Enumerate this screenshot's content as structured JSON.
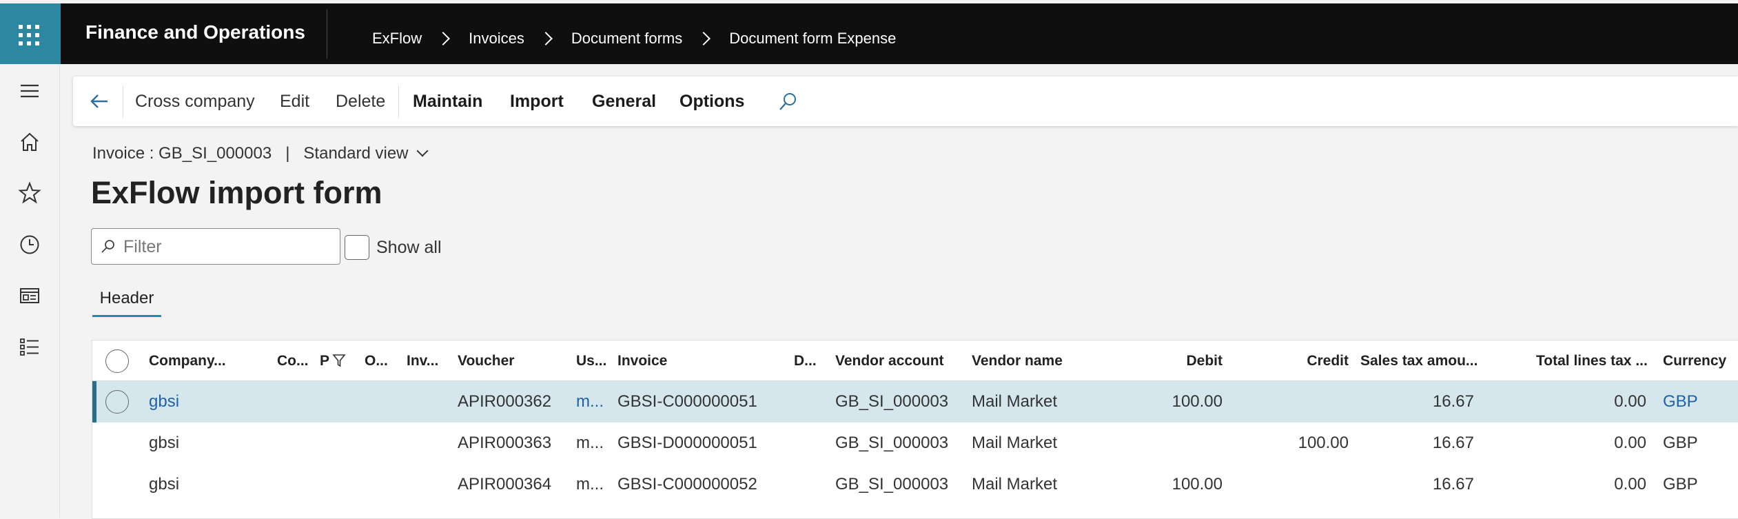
{
  "app": {
    "title": "Finance and Operations"
  },
  "breadcrumb": [
    "ExFlow",
    "Invoices",
    "Document forms",
    "Document form Expense"
  ],
  "actions": {
    "cross_company": "Cross company",
    "edit": "Edit",
    "delete": "Delete",
    "maintain": "Maintain",
    "import": "Import",
    "general": "General",
    "options": "Options"
  },
  "header": {
    "record": "Invoice : GB_SI_000003",
    "separator": "|",
    "view": "Standard view",
    "title": "ExFlow import form"
  },
  "filter": {
    "placeholder": "Filter",
    "show_all_label": "Show all"
  },
  "tabs": [
    "Header"
  ],
  "table": {
    "columns": [
      "Company...",
      "Co...",
      "P",
      "O...",
      "Inv...",
      "Voucher",
      "Us...",
      "Invoice",
      "D...",
      "Vendor account",
      "Vendor name",
      "Debit",
      "Credit",
      "Sales tax amou...",
      "Total lines tax ...",
      "Currency"
    ],
    "rows": [
      {
        "company": "gbsi",
        "voucher": "APIR000362",
        "user": "m...",
        "invoice": "GBSI-C000000051",
        "vendor_account": "GB_SI_000003",
        "vendor_name": "Mail Market",
        "debit": "100.00",
        "credit": "",
        "sales_tax": "16.67",
        "total_lines_tax": "0.00",
        "currency": "GBP"
      },
      {
        "company": "gbsi",
        "voucher": "APIR000363",
        "user": "m...",
        "invoice": "GBSI-D000000051",
        "vendor_account": "GB_SI_000003",
        "vendor_name": "Mail Market",
        "debit": "",
        "credit": "100.00",
        "sales_tax": "16.67",
        "total_lines_tax": "0.00",
        "currency": "GBP"
      },
      {
        "company": "gbsi",
        "voucher": "APIR000364",
        "user": "m...",
        "invoice": "GBSI-C000000052",
        "vendor_account": "GB_SI_000003",
        "vendor_name": "Mail Market",
        "debit": "100.00",
        "credit": "",
        "sales_tax": "16.67",
        "total_lines_tax": "0.00",
        "currency": "GBP"
      }
    ]
  },
  "colors": {
    "accent": "#2b88a0",
    "top_bar": "#0f0f0f",
    "selected_row": "#d5e7ec",
    "link": "#1f61a8"
  },
  "icons": [
    "waffle-icon",
    "hamburger-icon",
    "home-icon",
    "star-icon",
    "clock-icon",
    "workspace-icon",
    "modules-icon",
    "back-arrow-icon",
    "search-icon",
    "filter-search-icon",
    "column-filter-icon"
  ]
}
